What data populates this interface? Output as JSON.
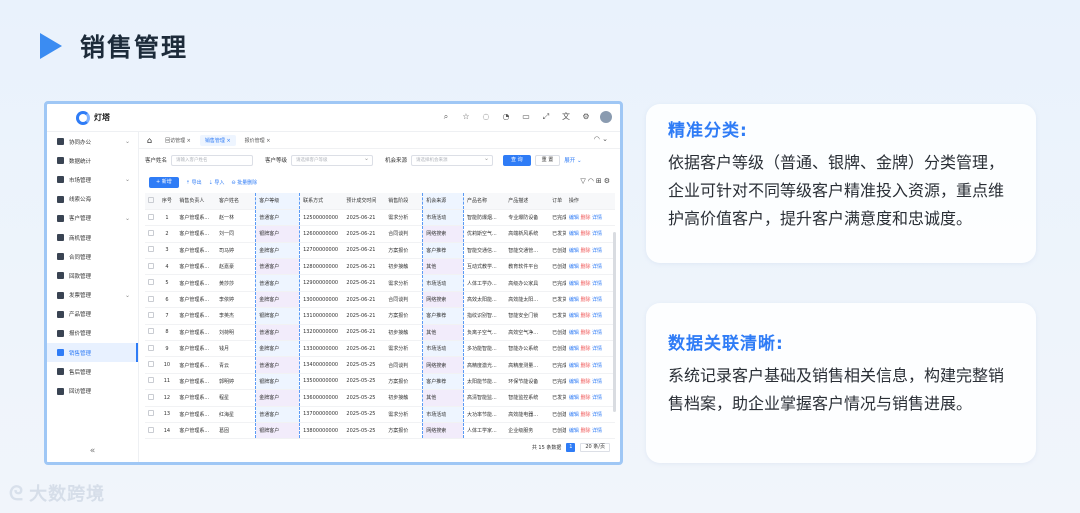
{
  "slide": {
    "title": "销售管理"
  },
  "app": {
    "name": "灯塔",
    "sidebar": [
      {
        "label": "协同办公",
        "expand": true
      },
      {
        "label": "数据统计"
      },
      {
        "label": "市场管理",
        "expand": true
      },
      {
        "label": "线索公海"
      },
      {
        "label": "客户管理",
        "expand": true
      },
      {
        "label": "商机管理"
      },
      {
        "label": "合同管理"
      },
      {
        "label": "回款管理"
      },
      {
        "label": "发票管理",
        "expand": true
      },
      {
        "label": "产品管理"
      },
      {
        "label": "报价管理"
      },
      {
        "label": "销售管理",
        "active": true
      },
      {
        "label": "售后管理"
      },
      {
        "label": "回访管理"
      }
    ],
    "collapse_icon": "«",
    "tabs": [
      {
        "label": "回访管理 ×"
      },
      {
        "label": "销售管理 ×",
        "active": true
      },
      {
        "label": "报价管理 ×"
      }
    ],
    "filter": {
      "customer_name_label": "客户姓名",
      "customer_name_placeholder": "请输入客户姓名",
      "customer_level_label": "客户等级",
      "customer_level_placeholder": "请选择客户等级",
      "source_label": "机会来源",
      "source_placeholder": "请选择机会来源",
      "query": "查 询",
      "reset": "重 置",
      "expand": "展开 ⌄"
    },
    "toolbar": {
      "new": "+ 新增",
      "export": "导出",
      "import": "导入",
      "batch_delete": "批量删除"
    },
    "columns": [
      "序号",
      "销售负责人",
      "客户姓名",
      "客户等级",
      "联系方式",
      "预计成交时间",
      "销售阶段",
      "机会来源",
      "产品名称",
      "产品描述",
      "订单",
      "操作"
    ],
    "rows": [
      [
        "1",
        "客户管理系...",
        "赵一林",
        "普通客户",
        "12500000000",
        "2025-06-21",
        "需求分析",
        "市场活动",
        "智能防爆烟...",
        "专业爆防设备",
        "已完成"
      ],
      [
        "2",
        "客户管理系...",
        "刘一同",
        "银牌客户",
        "12600000000",
        "2025-06-21",
        "合同谈判",
        "网络搜索",
        "优莉斯空气...",
        "高端新风系统",
        "已发货"
      ],
      [
        "3",
        "客户管理系...",
        "司马婷",
        "金牌客户",
        "12700000000",
        "2025-06-21",
        "方案报价",
        "客户推荐",
        "智能交通信...",
        "智能交通管...",
        "已创建"
      ],
      [
        "4",
        "客户管理系...",
        "赵嘉豪",
        "普通客户",
        "12800000000",
        "2025-06-21",
        "初步接触",
        "其他",
        "互动式教学...",
        "教育软件平台",
        "已创建"
      ],
      [
        "5",
        "客户管理系...",
        "黄莎莎",
        "普通客户",
        "12900000000",
        "2025-06-21",
        "需求分析",
        "市场活动",
        "人体工学办...",
        "高级办公家具",
        "已完成"
      ],
      [
        "6",
        "客户管理系...",
        "李依婷",
        "金牌客户",
        "13000000000",
        "2025-06-21",
        "合同谈判",
        "网络搜索",
        "高效太阳能...",
        "高效能太阳...",
        "已发货"
      ],
      [
        "7",
        "客户管理系...",
        "李英杰",
        "银牌客户",
        "13100000000",
        "2025-06-21",
        "方案报价",
        "客户推荐",
        "指纹识别智...",
        "智能安全门锁",
        "已发货"
      ],
      [
        "8",
        "客户管理系...",
        "刘荷明",
        "普通客户",
        "13200000000",
        "2025-06-21",
        "初步接触",
        "其他",
        "负离子空气...",
        "高效空气净...",
        "已创建"
      ],
      [
        "9",
        "客户管理系...",
        "钱月",
        "金牌客户",
        "13300000000",
        "2025-06-21",
        "需求分析",
        "市场活动",
        "多功能智能...",
        "智能办公系统",
        "已创建"
      ],
      [
        "10",
        "客户管理系...",
        "青云",
        "普通客户",
        "13400000000",
        "2025-05-25",
        "合同谈判",
        "网络搜索",
        "高精度激光...",
        "高精度测量...",
        "已完成"
      ],
      [
        "11",
        "客户管理系...",
        "郭明婷",
        "银牌客户",
        "13500000000",
        "2025-05-25",
        "方案报价",
        "客户推荐",
        "太阳能节能...",
        "环保节能设备",
        "已完成"
      ],
      [
        "12",
        "客户管理系...",
        "程星",
        "金牌客户",
        "13600000000",
        "2025-05-25",
        "初步接触",
        "其他",
        "高清智能监...",
        "智能监控系统",
        "已发货"
      ],
      [
        "13",
        "客户管理系...",
        "红海星",
        "普通客户",
        "13700000000",
        "2025-05-25",
        "需求分析",
        "市场活动",
        "大功率节能...",
        "高效能电器...",
        "已创建"
      ],
      [
        "14",
        "客户管理系...",
        "葛固",
        "银牌客户",
        "13800000000",
        "2025-05-25",
        "方案报价",
        "网络搜索",
        "人体工学家...",
        "企业级服务",
        "已创建"
      ]
    ],
    "actions": {
      "edit": "编辑",
      "delete": "删除",
      "detail": "详情"
    },
    "pager": {
      "total": "共 15 条数据",
      "page": "1",
      "size": "20 条/页"
    }
  },
  "cards": [
    {
      "title": "精准分类:",
      "body": "依据客户等级（普通、银牌、金牌）分类管理，企业可针对不同等级客户精准投入资源，重点维护高价值客户，提升客户满意度和忠诚度。"
    },
    {
      "title": "数据关联清晰:",
      "body": "系统记录客户基础及销售相关信息，构建完整销售档案，助企业掌握客户情况与销售进展。"
    }
  ],
  "brand": {
    "text": "大数跨境"
  }
}
